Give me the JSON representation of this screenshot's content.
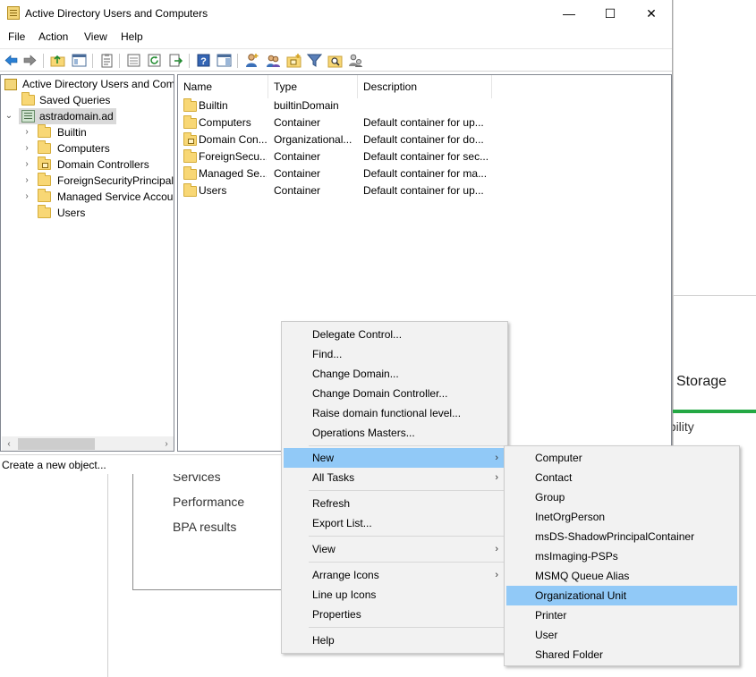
{
  "background": {
    "tile_title": "Storage",
    "tile_item": "ability",
    "list_items": [
      "Services",
      "Performance",
      "BPA results"
    ]
  },
  "window": {
    "title": "Active Directory Users and Computers",
    "controls": {
      "minimize": "—",
      "maximize": "☐",
      "close": "✕"
    }
  },
  "menubar": [
    "File",
    "Action",
    "View",
    "Help"
  ],
  "tree": {
    "root": "Active Directory Users and Computers",
    "saved_queries": "Saved Queries",
    "domain": "astradomain.ad",
    "children": [
      "Builtin",
      "Computers",
      "Domain Controllers",
      "ForeignSecurityPrincipals",
      "Managed Service Accounts",
      "Users"
    ]
  },
  "list": {
    "columns": [
      "Name",
      "Type",
      "Description"
    ],
    "rows": [
      {
        "name": "Builtin",
        "type": "builtinDomain",
        "description": ""
      },
      {
        "name": "Computers",
        "type": "Container",
        "description": "Default container for up..."
      },
      {
        "name": "Domain Con...",
        "type": "Organizational...",
        "description": "Default container for do..."
      },
      {
        "name": "ForeignSecu...",
        "type": "Container",
        "description": "Default container for sec..."
      },
      {
        "name": "Managed Se...",
        "type": "Container",
        "description": "Default container for ma..."
      },
      {
        "name": "Users",
        "type": "Container",
        "description": "Default container for up..."
      }
    ]
  },
  "status": "Create a new object...",
  "context_menu": {
    "items": [
      "Delegate Control...",
      "Find...",
      "Change Domain...",
      "Change Domain Controller...",
      "Raise domain functional level...",
      "Operations Masters...",
      "New",
      "All Tasks",
      "Refresh",
      "Export List...",
      "View",
      "Arrange Icons",
      "Line up Icons",
      "Properties",
      "Help"
    ],
    "highlighted": "New"
  },
  "submenu_new": {
    "items": [
      "Computer",
      "Contact",
      "Group",
      "InetOrgPerson",
      "msDS-ShadowPrincipalContainer",
      "msImaging-PSPs",
      "MSMQ Queue Alias",
      "Organizational Unit",
      "Printer",
      "User",
      "Shared Folder"
    ],
    "highlighted": "Organizational Unit"
  },
  "colors": {
    "highlight": "#91c9f7",
    "menu_bg": "#f2f2f2",
    "tree_selection": "#d9d9d9"
  }
}
